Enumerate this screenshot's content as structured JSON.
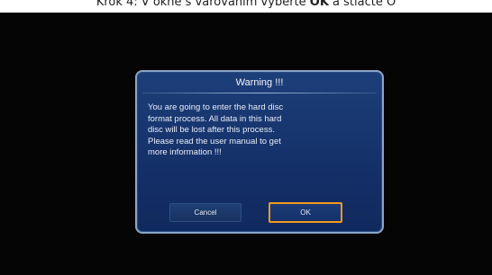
{
  "caption": {
    "prefix": "Krok 4: V okně s varováním vyberte ",
    "bold": "OK",
    "suffix": " a stlačte O"
  },
  "dialog": {
    "title": "Warning !!!",
    "message_lines": [
      "You are going to enter the hard disc",
      "format process. All data in this hard",
      "disc will be lost after this process.",
      "Please read the user manual to get",
      "more information !!!"
    ],
    "cancel_label": "Cancel",
    "ok_label": "OK",
    "selected_button": "OK"
  },
  "colors": {
    "dialog_background": "#143069",
    "dialog_border": "#8da4c8",
    "focus_border": "#f39a1f",
    "screen_background": "#050505"
  }
}
